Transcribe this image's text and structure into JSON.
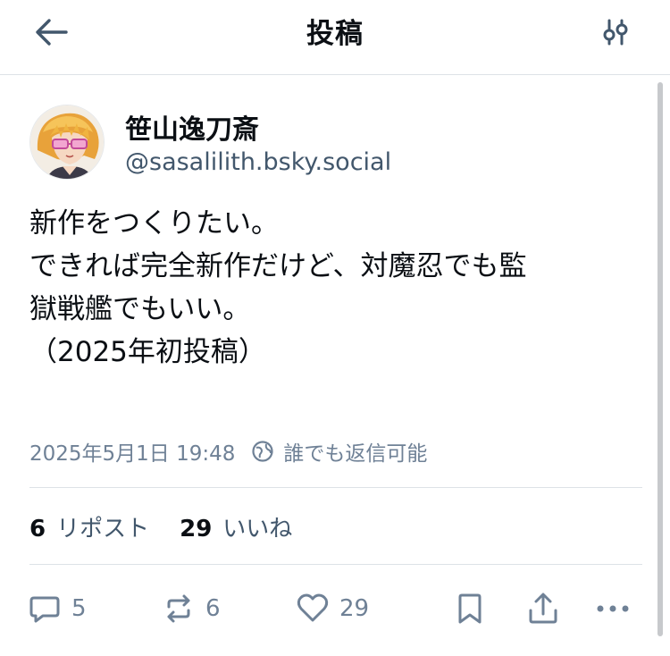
{
  "header": {
    "title": "投稿",
    "back_icon": "arrow-left-icon",
    "filter_icon": "sliders-icon"
  },
  "post": {
    "author": {
      "display_name": "笹山逸刀斎",
      "handle": "@sasalilith.bsky.social"
    },
    "text_lines": [
      "新作をつくりたい。",
      "できれば完全新作だけど、対魔忍でも監",
      "獄戦艦でもいい。",
      "（2025年初投稿）"
    ],
    "timestamp": "2025年5月1日 19:48",
    "reply_setting_icon": "globe-icon",
    "reply_setting": "誰でも返信可能",
    "stats": {
      "reposts_count": "6",
      "reposts_label": "リポスト",
      "likes_count": "29",
      "likes_label": "いいね"
    },
    "actions": {
      "reply_count": "5",
      "repost_count": "6",
      "like_count": "29"
    }
  },
  "colors": {
    "text_primary": "#0b0f14",
    "text_secondary": "#42576c",
    "text_muted": "#6f8196",
    "divider": "#dde2e7"
  }
}
